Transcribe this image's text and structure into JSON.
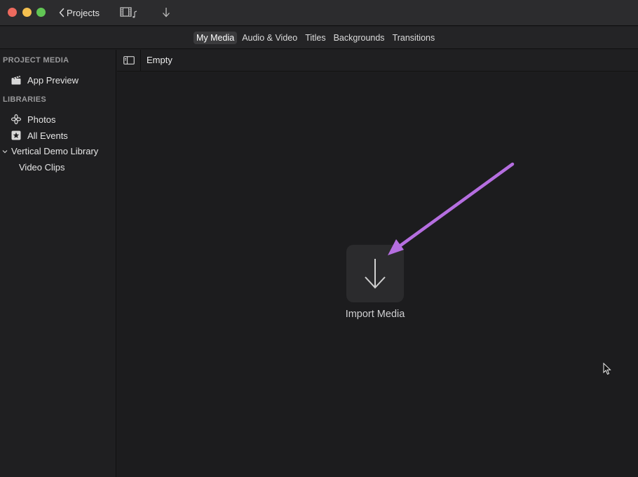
{
  "titlebar": {
    "back_label": "Projects",
    "media_icon": "film-music-icon",
    "import_icon": "download-arrow-icon"
  },
  "tabs": [
    {
      "label": "My Media",
      "active": true
    },
    {
      "label": "Audio & Video",
      "active": false
    },
    {
      "label": "Titles",
      "active": false
    },
    {
      "label": "Backgrounds",
      "active": false
    },
    {
      "label": "Transitions",
      "active": false
    }
  ],
  "sidebar": {
    "project_media_header": "PROJECT MEDIA",
    "project_items": [
      {
        "label": "App Preview",
        "icon": "clapperboard-icon"
      }
    ],
    "libraries_header": "LIBRARIES",
    "library_items": [
      {
        "label": "Photos",
        "icon": "photos-flower-icon"
      },
      {
        "label": "All Events",
        "icon": "star-box-icon"
      },
      {
        "label": "Vertical Demo Library",
        "icon": "chevron-down-icon"
      },
      {
        "label": "Video Clips",
        "icon": ""
      }
    ]
  },
  "browser": {
    "title": "Empty",
    "import_label": "Import Media"
  },
  "colors": {
    "annotation_arrow": "#b56ee0",
    "background": "#1e1e20",
    "titlebar": "#2c2c2e"
  }
}
